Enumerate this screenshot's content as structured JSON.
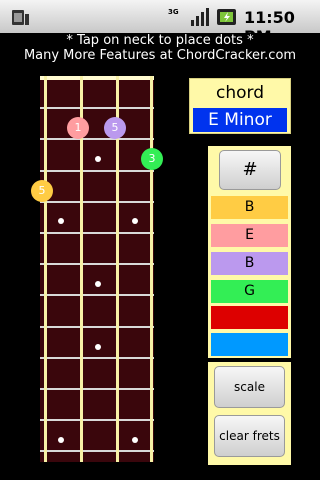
{
  "status_bar": {
    "network": "3G",
    "clock": "11:50 PM",
    "icons": [
      "sim-card-icon",
      "signal-bars-icon",
      "battery-charging-icon"
    ]
  },
  "header": {
    "line1": "* Tap on neck to place dots *",
    "line2": "Many More Features at ChordCracker.com"
  },
  "fretboard": {
    "strings": 4,
    "frets_shown": 12,
    "finger_dots": [
      {
        "string": 2,
        "fret": 1,
        "label": "1",
        "color": "#ff9da0"
      },
      {
        "string": 3,
        "fret": 1,
        "label": "5",
        "color": "#bb99ee"
      },
      {
        "string": 4,
        "fret": 2,
        "label": "3",
        "color": "#33ee55"
      },
      {
        "string": 1,
        "fret": 3,
        "label": "5",
        "color": "#ffcc44"
      }
    ]
  },
  "chord": {
    "label": "chord",
    "name": "E Minor",
    "name_bg": "#0033ee"
  },
  "notes_panel": {
    "sharp_label": "#",
    "notes": [
      {
        "text": "B",
        "color": "#ffcc44"
      },
      {
        "text": "E",
        "color": "#ff9da0"
      },
      {
        "text": "B",
        "color": "#bb99ee"
      },
      {
        "text": "G",
        "color": "#33ee55"
      },
      {
        "text": "",
        "color": "#dd0000"
      },
      {
        "text": "",
        "color": "#0099ff"
      }
    ]
  },
  "controls": {
    "scale_label": "scale",
    "clear_label": "clear frets"
  }
}
